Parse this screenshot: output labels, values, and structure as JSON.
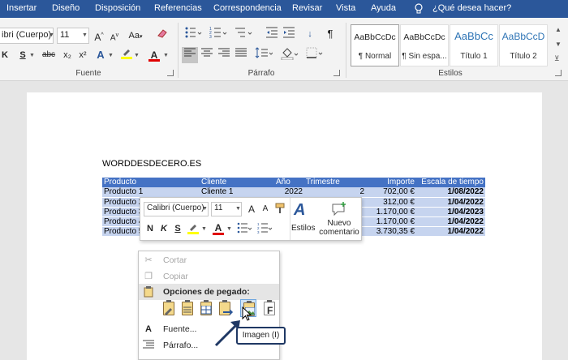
{
  "ribbon_tabs": [
    "Insertar",
    "Diseño",
    "Disposición",
    "Referencias",
    "Correspondencia",
    "Revisar",
    "Vista",
    "Ayuda"
  ],
  "tell_me": "¿Qué desea hacer?",
  "font_group": {
    "font_name": "ibri (Cuerpo)",
    "font_size": "11",
    "label": "Fuente",
    "grow": "A",
    "case": "Aa",
    "bold": "K",
    "strike": "abc",
    "sub": "x₂",
    "sup": "x²",
    "underline": "S"
  },
  "paragraph_group": {
    "label": "Párrafo",
    "sort": "↓",
    "pilcrow": "¶"
  },
  "styles_group": {
    "label": "Estilos",
    "styles": [
      {
        "preview": "AaBbCcDc",
        "name": "¶ Normal"
      },
      {
        "preview": "AaBbCcDc",
        "name": "¶ Sin espa..."
      },
      {
        "preview": "AaBbCc",
        "name": "Título 1"
      },
      {
        "preview": "AaBbCcD",
        "name": "Título 2"
      }
    ]
  },
  "document": {
    "title": "WORDDESDECERO.ES",
    "headers": [
      "Producto",
      "Cliente",
      "Año",
      "Trimestre",
      "Importe",
      "Escala de tiempo"
    ],
    "rows": [
      [
        "Producto 1",
        "Cliente 1",
        "2022",
        "2",
        "702,00 €",
        "1/08/2022"
      ],
      [
        "Producto 2",
        "",
        "",
        "",
        "312,00 €",
        "1/04/2022"
      ],
      [
        "Producto 3",
        "",
        "",
        "",
        "1.170,00 €",
        "1/04/2023"
      ],
      [
        "Producto 4",
        "",
        "",
        "",
        "1.170,00 €",
        "1/04/2022"
      ],
      [
        "Producto 5",
        "",
        "",
        "",
        "3.730,35 €",
        "1/04/2022"
      ]
    ]
  },
  "mini_toolbar": {
    "font": "Calibri (Cuerpo)",
    "size": "11",
    "grow": "A",
    "shrink": "A",
    "bold": "N",
    "italic": "K",
    "underline": "S",
    "styles_label": "Estilos",
    "comment_label_1": "Nuevo",
    "comment_label_2": "comentario"
  },
  "context_menu": {
    "cut": "Cortar",
    "copy": "Copiar",
    "paste_header": "Opciones de pegado:",
    "font": "Fuente...",
    "paragraph": "Párrafo..."
  },
  "tooltip": "Imagen (I)",
  "colors": {
    "ribbon_blue": "#2b579a",
    "table_header": "#4472c4",
    "table_band": "#c6d4ef",
    "highlight": "#ffff00",
    "font_red": "#e00000",
    "annotation_arrow": "#1f3864"
  }
}
